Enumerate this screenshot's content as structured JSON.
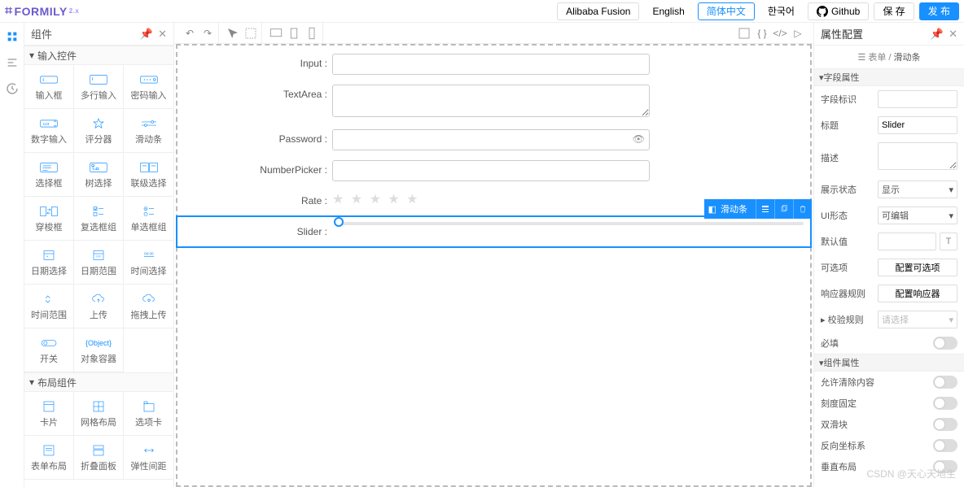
{
  "header": {
    "logo_text": "FORMILY",
    "logo_badge": "2.x",
    "theme": "Alibaba Fusion",
    "langs": [
      "English",
      "简体中文",
      "한국어"
    ],
    "active_lang": 1,
    "github": "Github",
    "save": "保 存",
    "publish": "发 布"
  },
  "left": {
    "title": "组件",
    "sections": {
      "inputs": {
        "title": "输入控件",
        "items": [
          "输入框",
          "多行输入",
          "密码输入",
          "数字输入",
          "评分器",
          "滑动条",
          "选择框",
          "树选择",
          "联级选择",
          "穿梭框",
          "复选框组",
          "单选框组",
          "日期选择",
          "日期范围",
          "时间选择",
          "时间范围",
          "上传",
          "拖拽上传",
          "开关",
          "对象容器"
        ]
      },
      "layouts": {
        "title": "布局组件",
        "items": [
          "卡片",
          "网格布局",
          "选项卡",
          "表单布局",
          "折叠面板",
          "弹性间距"
        ]
      }
    },
    "icon_labels": {
      "object": "{Object}"
    }
  },
  "canvas": {
    "fields": [
      {
        "label": "Input",
        "type": "input"
      },
      {
        "label": "TextArea",
        "type": "textarea"
      },
      {
        "label": "Password",
        "type": "password"
      },
      {
        "label": "NumberPicker",
        "type": "input"
      },
      {
        "label": "Rate",
        "type": "rate"
      },
      {
        "label": "Slider",
        "type": "slider"
      }
    ],
    "selected_badge": "滑动条"
  },
  "right": {
    "title": "属性配置",
    "crumb_root": "表单",
    "crumb_cur": "滑动条",
    "sections": {
      "field": "字段属性",
      "component": "组件属性"
    },
    "rows": {
      "field_id": "字段标识",
      "title": "标题",
      "title_val": "Slider",
      "desc": "描述",
      "display": "展示状态",
      "display_val": "显示",
      "ui": "UI形态",
      "ui_val": "可编辑",
      "default": "默认值",
      "options": "可选项",
      "options_btn": "配置可选项",
      "reactions": "响应器规则",
      "reactions_btn": "配置响应器",
      "validator": "校验规则",
      "validator_ph": "请选择",
      "required": "必填",
      "allow_clear": "允许清除内容",
      "fixed": "刻度固定",
      "double": "双滑块",
      "reverse": "反向坐标系",
      "vertical": "垂直布局"
    }
  },
  "watermark": "CSDN @天心天地生"
}
